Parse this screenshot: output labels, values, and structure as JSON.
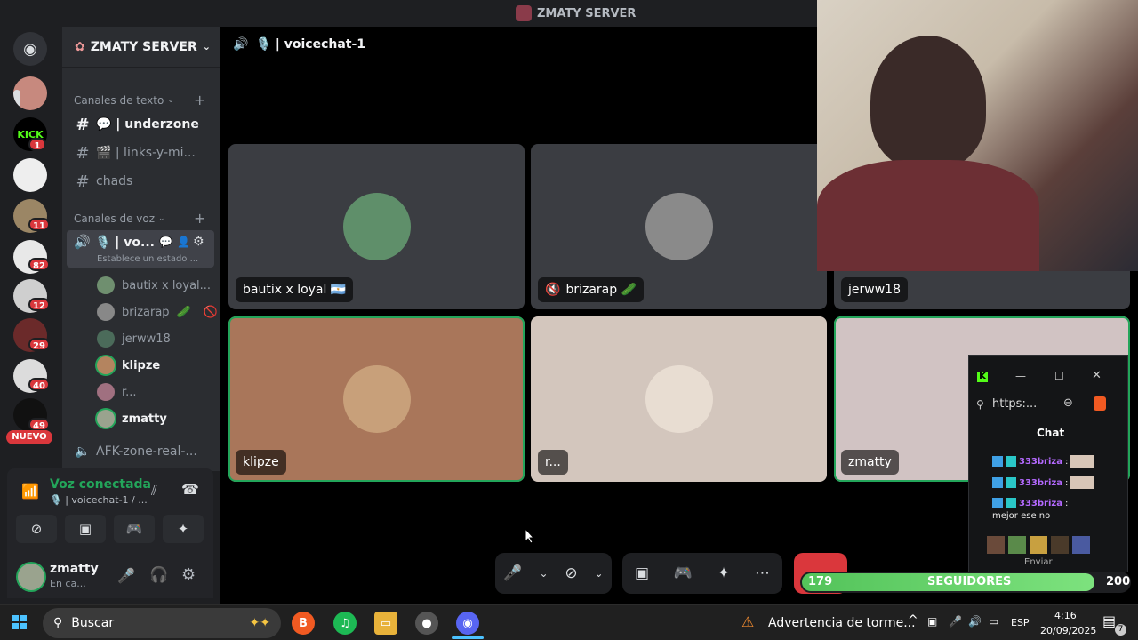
{
  "window": {
    "title": "ZMATY SERVER"
  },
  "rail": {
    "badges": [
      "1",
      "11",
      "82",
      "12",
      "29",
      "40",
      "49"
    ],
    "new_label": "NUEVO"
  },
  "sidebar": {
    "server_name": "ZMATY SERVER",
    "text_category": "Canales de texto",
    "voice_category": "Canales de voz",
    "text_channels": [
      "💬 | underzone",
      "🎬 | links-y-mi...",
      "chads"
    ],
    "voice_channel": {
      "name": "🎙️ | vo...",
      "status": "Establece un estado ..."
    },
    "members": [
      "bautix x loyal...",
      "brizarap",
      "jerww18",
      "klipze",
      "r...",
      "zmatty"
    ],
    "afk_channel": "AFK-zone-real-..."
  },
  "voice_panel": {
    "status": "Voz conectada",
    "channel": "🎙️ | voicechat-1 / ..."
  },
  "user_panel": {
    "username": "zmatty",
    "status": "En ca..."
  },
  "stage": {
    "channel_title": "🎙️ | voicechat-1",
    "tiles": [
      {
        "name": "bautix x loyal 🇦🇷",
        "bg": "#3b3d42"
      },
      {
        "name": "brizarap 🥒",
        "bg": "#3b3d42"
      },
      {
        "name": "jerww18",
        "bg": "#3b3d42"
      },
      {
        "name": "klipze",
        "bg": "#a9765a"
      },
      {
        "name": "r...",
        "bg": "#d3c6bd"
      },
      {
        "name": "zmatty",
        "bg": "#d1c3c3"
      }
    ]
  },
  "followers": {
    "current": "179",
    "label": "SEGUIDORES",
    "goal": "200",
    "progress": 0.895
  },
  "kick_chat": {
    "url": "https:...",
    "title": "Chat",
    "messages": [
      {
        "user": "333briza",
        "text": ""
      },
      {
        "user": "333briza",
        "text": ""
      },
      {
        "user": "333briza",
        "text": "mejor ese no"
      }
    ],
    "send_label": "Enviar"
  },
  "taskbar": {
    "search_placeholder": "Buscar",
    "weather": "Advertencia de torme...",
    "lang": "ESP",
    "time": "4:16",
    "date": "20/09/2025",
    "notif_count": "7"
  },
  "colors": {
    "accent_green": "#23a55a",
    "danger": "#da373c",
    "kick_green": "#53fc18"
  }
}
